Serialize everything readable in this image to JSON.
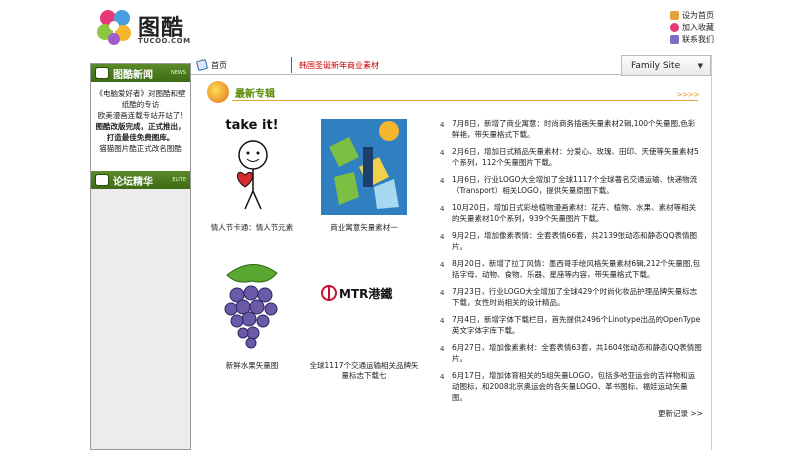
{
  "header": {
    "logo_text": "图酷",
    "logo_sub": "TUCOO.COM",
    "links": [
      {
        "label": "设为首页",
        "icon": "home-icon"
      },
      {
        "label": "加入收藏",
        "icon": "heart-icon"
      },
      {
        "label": "联系我们",
        "icon": "mail-icon"
      }
    ]
  },
  "sidebar": {
    "section1_title": "图酷新闻",
    "section1_tag": "NEWS",
    "items": [
      "《电脑爱好者》对图酷和壁纸酷的专访",
      "欧美漫画连载专站开站了!",
      "图酷改版完成，正式推出，打造最佳免费图库。",
      "猫猫图片酷正式改名图酷"
    ],
    "section2_title": "论坛精华",
    "section2_tag": "ELITE"
  },
  "nav": {
    "home_label": "首页",
    "promo_label": "韩国圣诞新年商业素材",
    "family_label": "Family Site",
    "family_arrow": "▼"
  },
  "main": {
    "section_title": "最新专辑",
    "title_arrows": ">>>>",
    "thumbs": [
      {
        "caption": "情人节卡通：情人节元素",
        "art_text": "take it!"
      },
      {
        "caption": "商业寓意矢量素材一"
      },
      {
        "caption": "新鲜水果矢量图"
      },
      {
        "caption": "全球1117个交通运输相关品牌矢量标志下载七",
        "art_text": "MTR港鐵"
      }
    ],
    "news": [
      "7月8日，新增了商业寓意：时尚商务插画矢量素材2辑,100个矢量图,色彩鲜艳，带矢量格式下载。",
      "2月6日，增加日式精品矢量素材：分爱心、玫瑰、田印、天使等矢量素材5个系列，112个矢量图片下载。",
      "1月6日，行业LOGO大全增加了全球1117个全球著名交通运输、快递物流（Transport）相关LOGO，提供矢量原图下载。",
      "10月20日，增加日式彩绘植物漫画素材：花卉、植物、水果、素材等相关的矢量素材10个系列，939个矢量图片下载。",
      "9月2日，增加像素表情：全套表情66套，共2139张动态和静态QQ表情图片。",
      "8月20日，新增了拉丁风情：墨西哥手绘风格矢量素材6辑,212个矢量图,包括字母、动物、食物、乐器、星座等内容，带矢量格式下载。",
      "7月23日，行业LOGO大全增加了全球429个时尚化妆品护理品牌矢量标志下载，女性时尚相关的设计精品。",
      "7月4日，新增字体下载栏目，首先提供2496个Linotype出品的OpenType英文字体字库下载。",
      "6月27日，增加像素素材：全套表情63套，共1604张动态和静态QQ表情图片。",
      "6月17日，增加体育相关的5组矢量LOGO，包括多哈亚运会的吉祥物和运动图标，和2008北京奥运会的各矢量LOGO、革书图标、福娃运动矢量图。"
    ],
    "news_bullet": "4",
    "more_label": "更新记录 >>"
  }
}
